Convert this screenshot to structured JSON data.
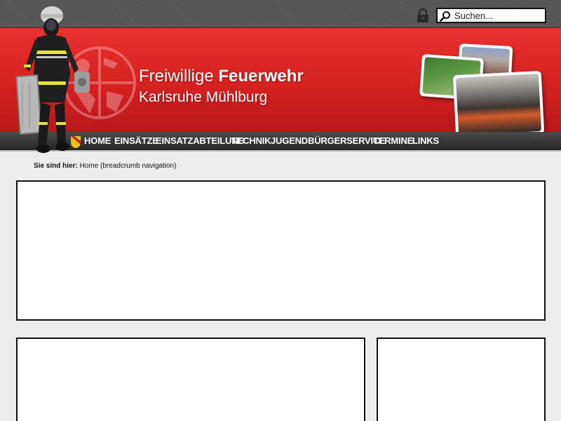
{
  "search": {
    "placeholder": "Suchen..."
  },
  "header": {
    "title_regular": "Freiwillige ",
    "title_bold": "Feuerwehr",
    "subtitle": "Karlsruhe Mühlburg"
  },
  "nav": {
    "items": [
      {
        "label": "HOME"
      },
      {
        "label": "EINSÄTZE"
      },
      {
        "label": "EINSATZABTEILUNG"
      },
      {
        "label": "TECHNIK"
      },
      {
        "label": "JUGEND"
      },
      {
        "label": "BÜRGERSERVICE"
      },
      {
        "label": "TERMINE"
      },
      {
        "label": "LINKS"
      }
    ]
  },
  "breadcrumb": {
    "prefix": "Sie sind hier:",
    "current": "Home (breadcrumb navigation)"
  },
  "icons": {
    "login": "lock-icon",
    "search": "search-icon",
    "crest": "crest-icon"
  },
  "colors": {
    "header_red": "#d5211f",
    "nav_dark": "#262626",
    "page_bg": "#ececec"
  }
}
